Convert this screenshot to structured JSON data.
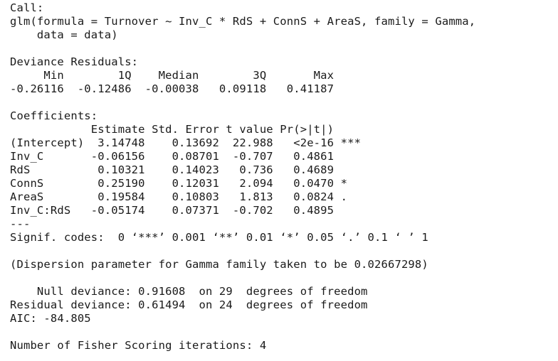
{
  "console": {
    "lines": [
      "Call:",
      "glm(formula = Turnover ~ Inv_C * RdS + ConnS + AreaS, family = Gamma,",
      "    data = data)",
      "",
      "Deviance Residuals:",
      "     Min        1Q    Median        3Q       Max",
      "-0.26116  -0.12486  -0.00038   0.09118   0.41187",
      "",
      "Coefficients:",
      "            Estimate Std. Error t value Pr(>|t|)",
      "(Intercept)  3.14748    0.13692  22.988   <2e-16 ***",
      "Inv_C       -0.06156    0.08701  -0.707   0.4861",
      "RdS          0.10321    0.14023   0.736   0.4689",
      "ConnS        0.25190    0.12031   2.094   0.0470 *",
      "AreaS        0.19584    0.10803   1.813   0.0824 .",
      "Inv_C:RdS   -0.05174    0.07371  -0.702   0.4895",
      "---",
      "Signif. codes:  0 ‘***’ 0.001 ‘**’ 0.01 ‘*’ 0.05 ‘.’ 0.1 ‘ ’ 1",
      "",
      "(Dispersion parameter for Gamma family taken to be 0.02667298)",
      "",
      "    Null deviance: 0.91608  on 29  degrees of freedom",
      "Residual deviance: 0.61494  on 24  degrees of freedom",
      "AIC: -84.805",
      "",
      "Number of Fisher Scoring iterations: 4"
    ]
  }
}
